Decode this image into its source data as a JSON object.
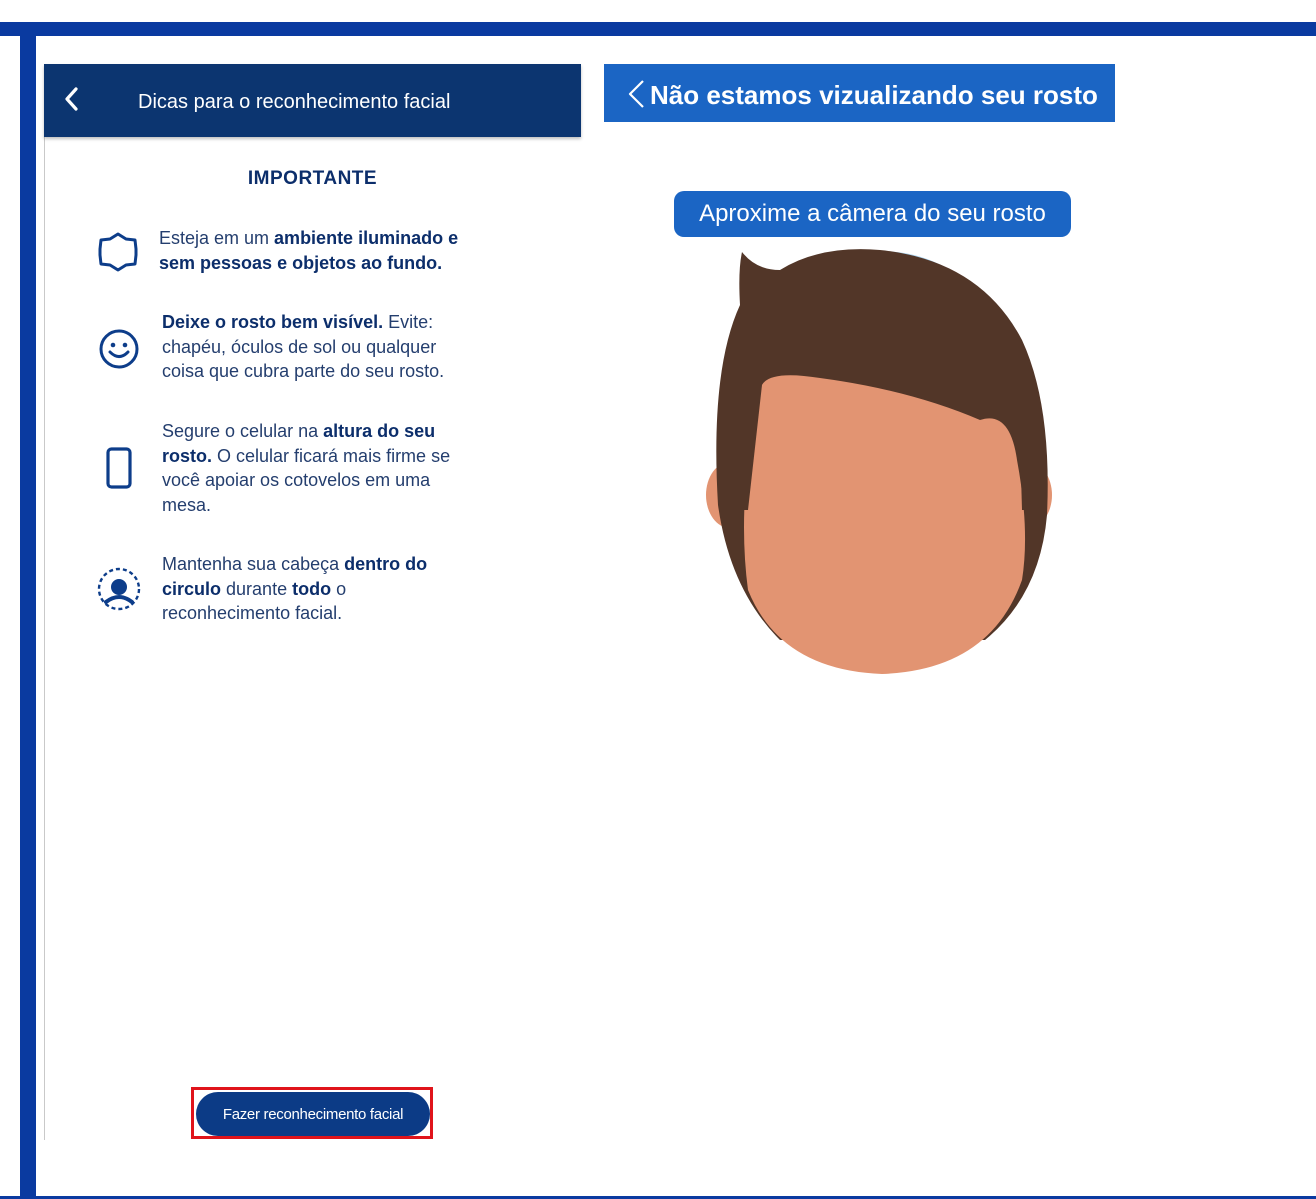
{
  "left_screen": {
    "header_title": "Dicas para o reconhecimento facial",
    "section_title": "IMPORTANTE",
    "tips": [
      {
        "icon": "sun-icon",
        "lines": [
          [
            {
              "t": "Esteja em um "
            },
            {
              "t": "ambiente iluminado e",
              "b": true
            }
          ],
          [
            {
              "t": "sem pessoas e objetos ao fundo.",
              "b": true
            }
          ]
        ]
      },
      {
        "icon": "smiley-icon",
        "lines": [
          [
            {
              "t": "Deixe o rosto bem visível.",
              "b": true
            },
            {
              "t": " Evite:"
            }
          ],
          [
            {
              "t": "chapéu, óculos de sol ou qualquer"
            }
          ],
          [
            {
              "t": "coisa que cubra parte do seu rosto."
            }
          ]
        ]
      },
      {
        "icon": "phone-icon",
        "lines": [
          [
            {
              "t": "Segure o celular na "
            },
            {
              "t": "altura do seu",
              "b": true
            }
          ],
          [
            {
              "t": "rosto.",
              "b": true
            },
            {
              "t": " O celular ficará mais firme se"
            }
          ],
          [
            {
              "t": "você apoiar os cotovelos em uma"
            }
          ],
          [
            {
              "t": "mesa."
            }
          ]
        ]
      },
      {
        "icon": "face-circle-icon",
        "lines": [
          [
            {
              "t": "Mantenha sua cabeça "
            },
            {
              "t": "dentro do",
              "b": true
            }
          ],
          [
            {
              "t": "circulo",
              "b": true
            },
            {
              "t": " durante "
            },
            {
              "t": "todo",
              "b": true
            },
            {
              "t": " o"
            }
          ],
          [
            {
              "t": "reconhecimento facial."
            }
          ]
        ]
      }
    ],
    "button_label": "Fazer reconhecimento facial"
  },
  "right_screen": {
    "header_title": "Não estamos vizualizando seu rosto",
    "instruction": "Aproxime a câmera do seu rosto"
  },
  "colors": {
    "frame": "#0a3aa0",
    "left_header": "#0c3570",
    "right_header": "#1b65c4",
    "text_dark": "#0c2e6b",
    "text_body": "#243e6e",
    "highlight": "#e0141b",
    "hair": "#523628",
    "skin": "#e29472",
    "face_guide": "#a9d3f0"
  }
}
